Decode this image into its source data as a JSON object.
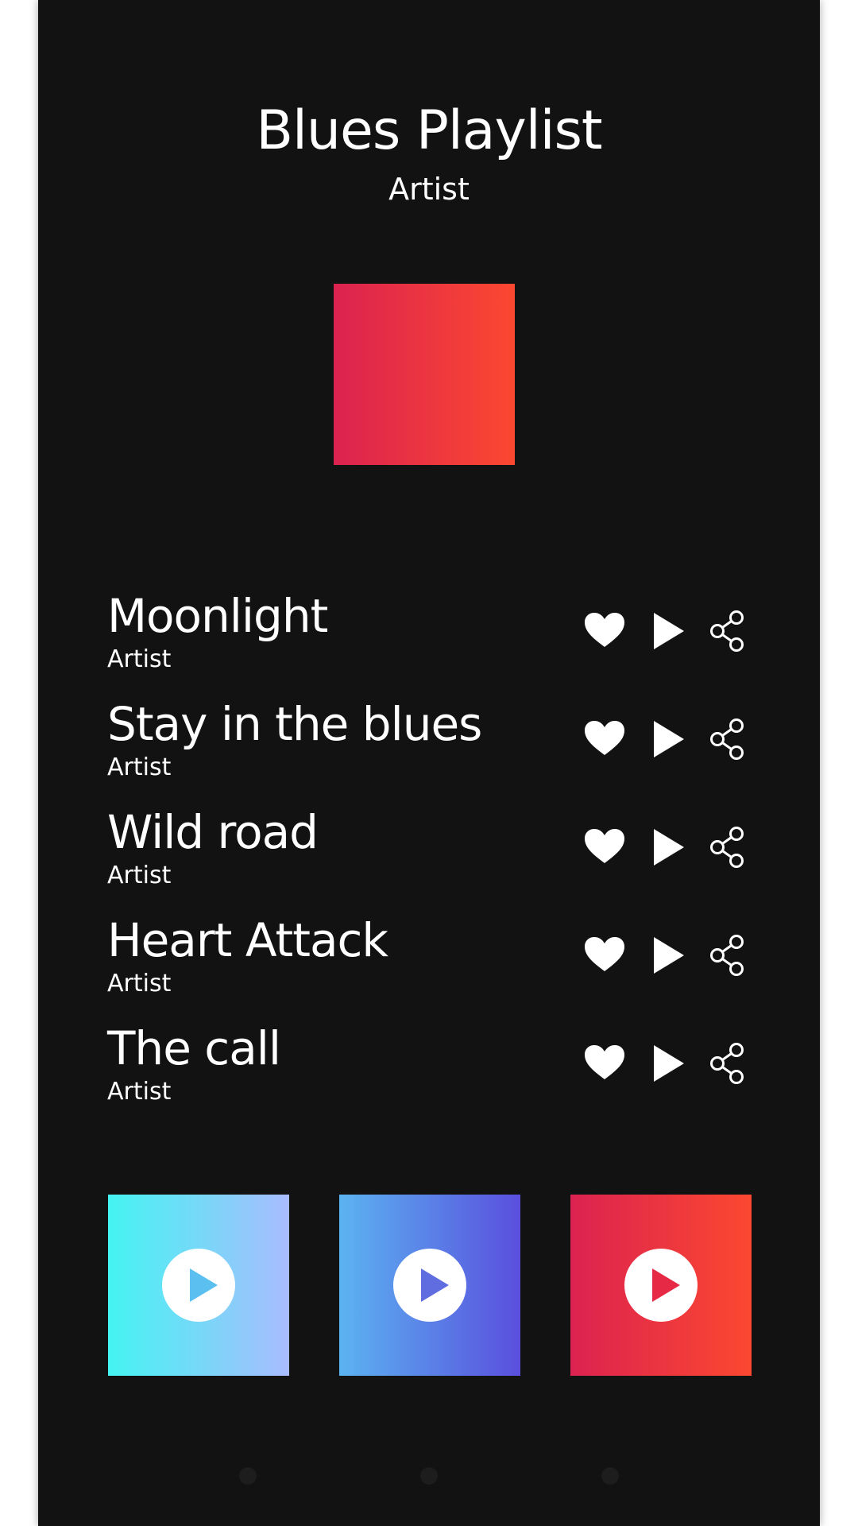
{
  "playlist": {
    "title": "Blues Playlist",
    "subtitle": "Artist",
    "cover_gradient": [
      "#dc2250",
      "#fb4830"
    ]
  },
  "tracks": [
    {
      "name": "Moonlight",
      "artist": "Artist"
    },
    {
      "name": "Stay in the blues",
      "artist": "Artist"
    },
    {
      "name": "Wild road",
      "artist": "Artist"
    },
    {
      "name": "Heart Attack",
      "artist": "Artist"
    },
    {
      "name": "The call",
      "artist": "Artist"
    }
  ],
  "track_actions": [
    "heart-icon",
    "play-icon",
    "share-icon"
  ],
  "featured": [
    {
      "gradient": [
        "#44f4f2",
        "#a9bcfe"
      ],
      "icon": "play-circle-icon",
      "accent": "#5bbff0"
    },
    {
      "gradient": [
        "#5bb3f1",
        "#5a4fdd"
      ],
      "icon": "play-circle-icon",
      "accent": "#5f6de0"
    },
    {
      "gradient": [
        "#dc2250",
        "#fb4830"
      ],
      "icon": "play-circle-icon",
      "accent": "#e62a45"
    }
  ],
  "pager": {
    "count": 3
  },
  "colors": {
    "background": "#121212",
    "text": "#ffffff",
    "dot": "#1d1d1d"
  }
}
